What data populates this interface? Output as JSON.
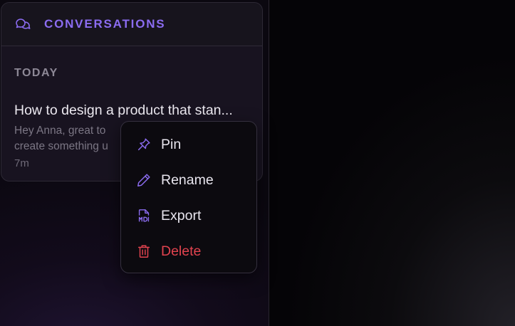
{
  "panel": {
    "header_icon": "chat-bubbles-icon",
    "title": "CONVERSATIONS",
    "section_label": "TODAY",
    "conversation": {
      "title": "How to design a product that stan...",
      "preview": "Hey Anna, great to ... create something u...",
      "preview_line1": "Hey Anna, great to",
      "preview_line2": "create something u",
      "time": "7m"
    }
  },
  "context_menu": {
    "items": [
      {
        "label": "Pin",
        "icon": "pin-icon"
      },
      {
        "label": "Rename",
        "icon": "pencil-icon"
      },
      {
        "label": "Export",
        "icon": "md-file-icon"
      },
      {
        "label": "Delete",
        "icon": "trash-icon"
      }
    ]
  },
  "colors": {
    "accent": "#8b6cf0",
    "danger": "#e2434f",
    "text_primary": "#ece9f0",
    "text_muted": "#7b7684"
  }
}
